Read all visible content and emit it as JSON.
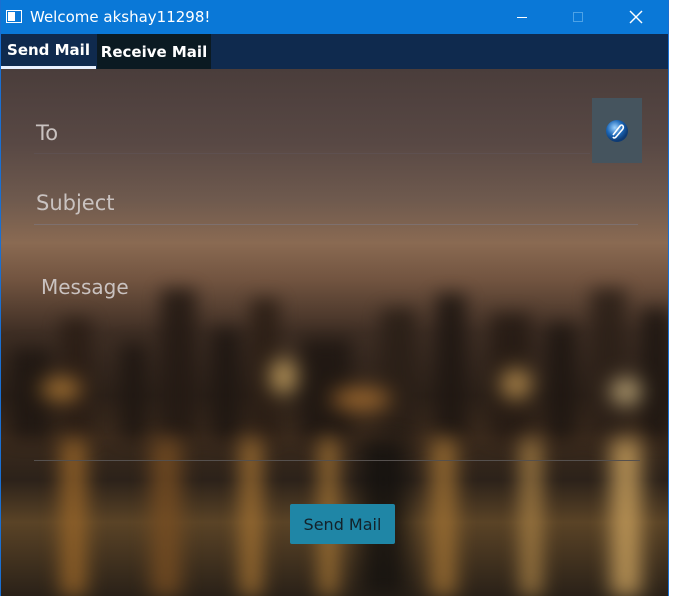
{
  "window": {
    "title": "Welcome akshay11298!",
    "icons": {
      "app": "app-window-icon",
      "minimize": "minimize-icon",
      "maximize": "maximize-icon",
      "close": "close-icon"
    }
  },
  "tabs": [
    {
      "label": "Send Mail",
      "selected": true
    },
    {
      "label": "Receive Mail",
      "selected": false
    }
  ],
  "form": {
    "to_placeholder": "To",
    "subject_placeholder": "Subject",
    "message_placeholder": "Message",
    "attach_icon": "attachment-globe-icon",
    "send_label": "Send Mail"
  },
  "colors": {
    "titlebar": "#0a78d7",
    "tabbar": "#0f2a4e",
    "send_button": "#1f86a6"
  }
}
